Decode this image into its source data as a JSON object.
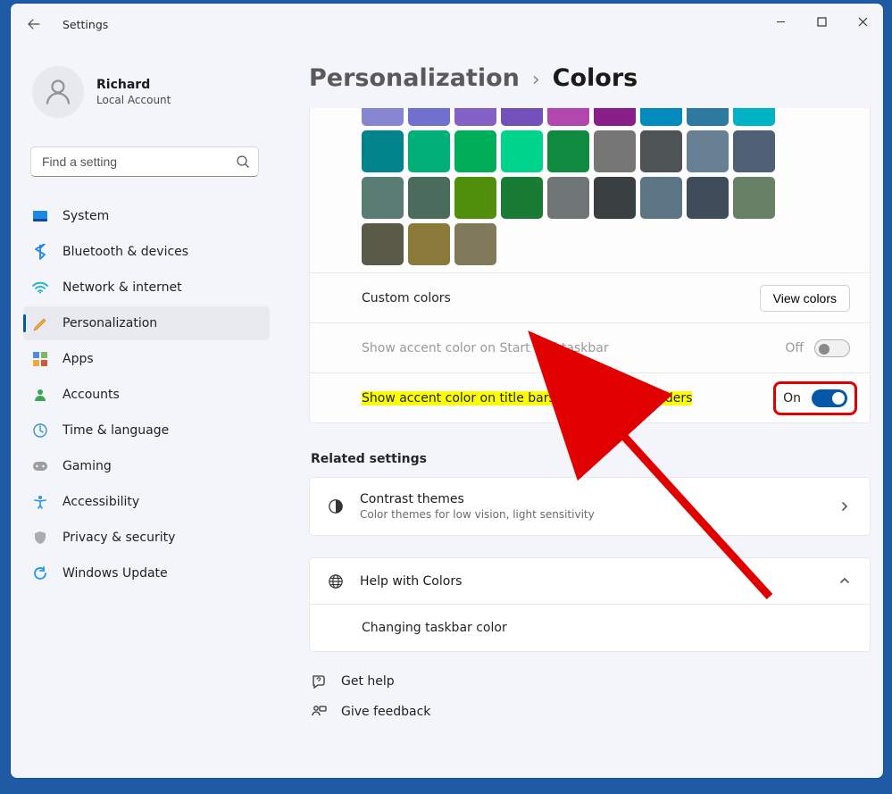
{
  "app_title": "Settings",
  "user": {
    "name": "Richard",
    "sub": "Local Account"
  },
  "search": {
    "placeholder": "Find a setting"
  },
  "nav": {
    "items": [
      {
        "label": "System"
      },
      {
        "label": "Bluetooth & devices"
      },
      {
        "label": "Network & internet"
      },
      {
        "label": "Personalization"
      },
      {
        "label": "Apps"
      },
      {
        "label": "Accounts"
      },
      {
        "label": "Time & language"
      },
      {
        "label": "Gaming"
      },
      {
        "label": "Accessibility"
      },
      {
        "label": "Privacy & security"
      },
      {
        "label": "Windows Update"
      }
    ],
    "active_index": 3
  },
  "breadcrumb": {
    "parent": "Personalization",
    "current": "Colors"
  },
  "colors_grid": {
    "rows": [
      [
        "#8787d1",
        "#7070cf",
        "#8461c5",
        "#7451ba",
        "#b247ad",
        "#8a1f89",
        "#038bbd",
        "#2d79a0",
        "#00b2c3"
      ],
      [
        "#00838b",
        "#00b076",
        "#00ad58",
        "#00d38c",
        "#0f8a3f",
        "#767676",
        "#4e5355",
        "#688094",
        "#4f6076"
      ],
      [
        "#597d72",
        "#4b6c5d",
        "#4f8f0b",
        "#187c34",
        "#6f7474",
        "#3a4041",
        "#5b7585",
        "#3f4c5a",
        "#668166"
      ],
      [
        "#595a47",
        "#8b7a39",
        "#817a5a"
      ]
    ]
  },
  "rows": {
    "custom": {
      "label": "Custom colors",
      "button": "View colors"
    },
    "start_taskbar": {
      "label": "Show accent color on Start and taskbar",
      "state": "Off",
      "enabled": false
    },
    "titlebars": {
      "label": "Show accent color on title bars and windows borders",
      "state": "On",
      "enabled": true
    }
  },
  "related_heading": "Related settings",
  "contrast": {
    "title": "Contrast themes",
    "sub": "Color themes for low vision, light sensitivity"
  },
  "help": {
    "title": "Help with Colors",
    "sub": "Changing taskbar color"
  },
  "footer": {
    "get_help": "Get help",
    "feedback": "Give feedback"
  }
}
